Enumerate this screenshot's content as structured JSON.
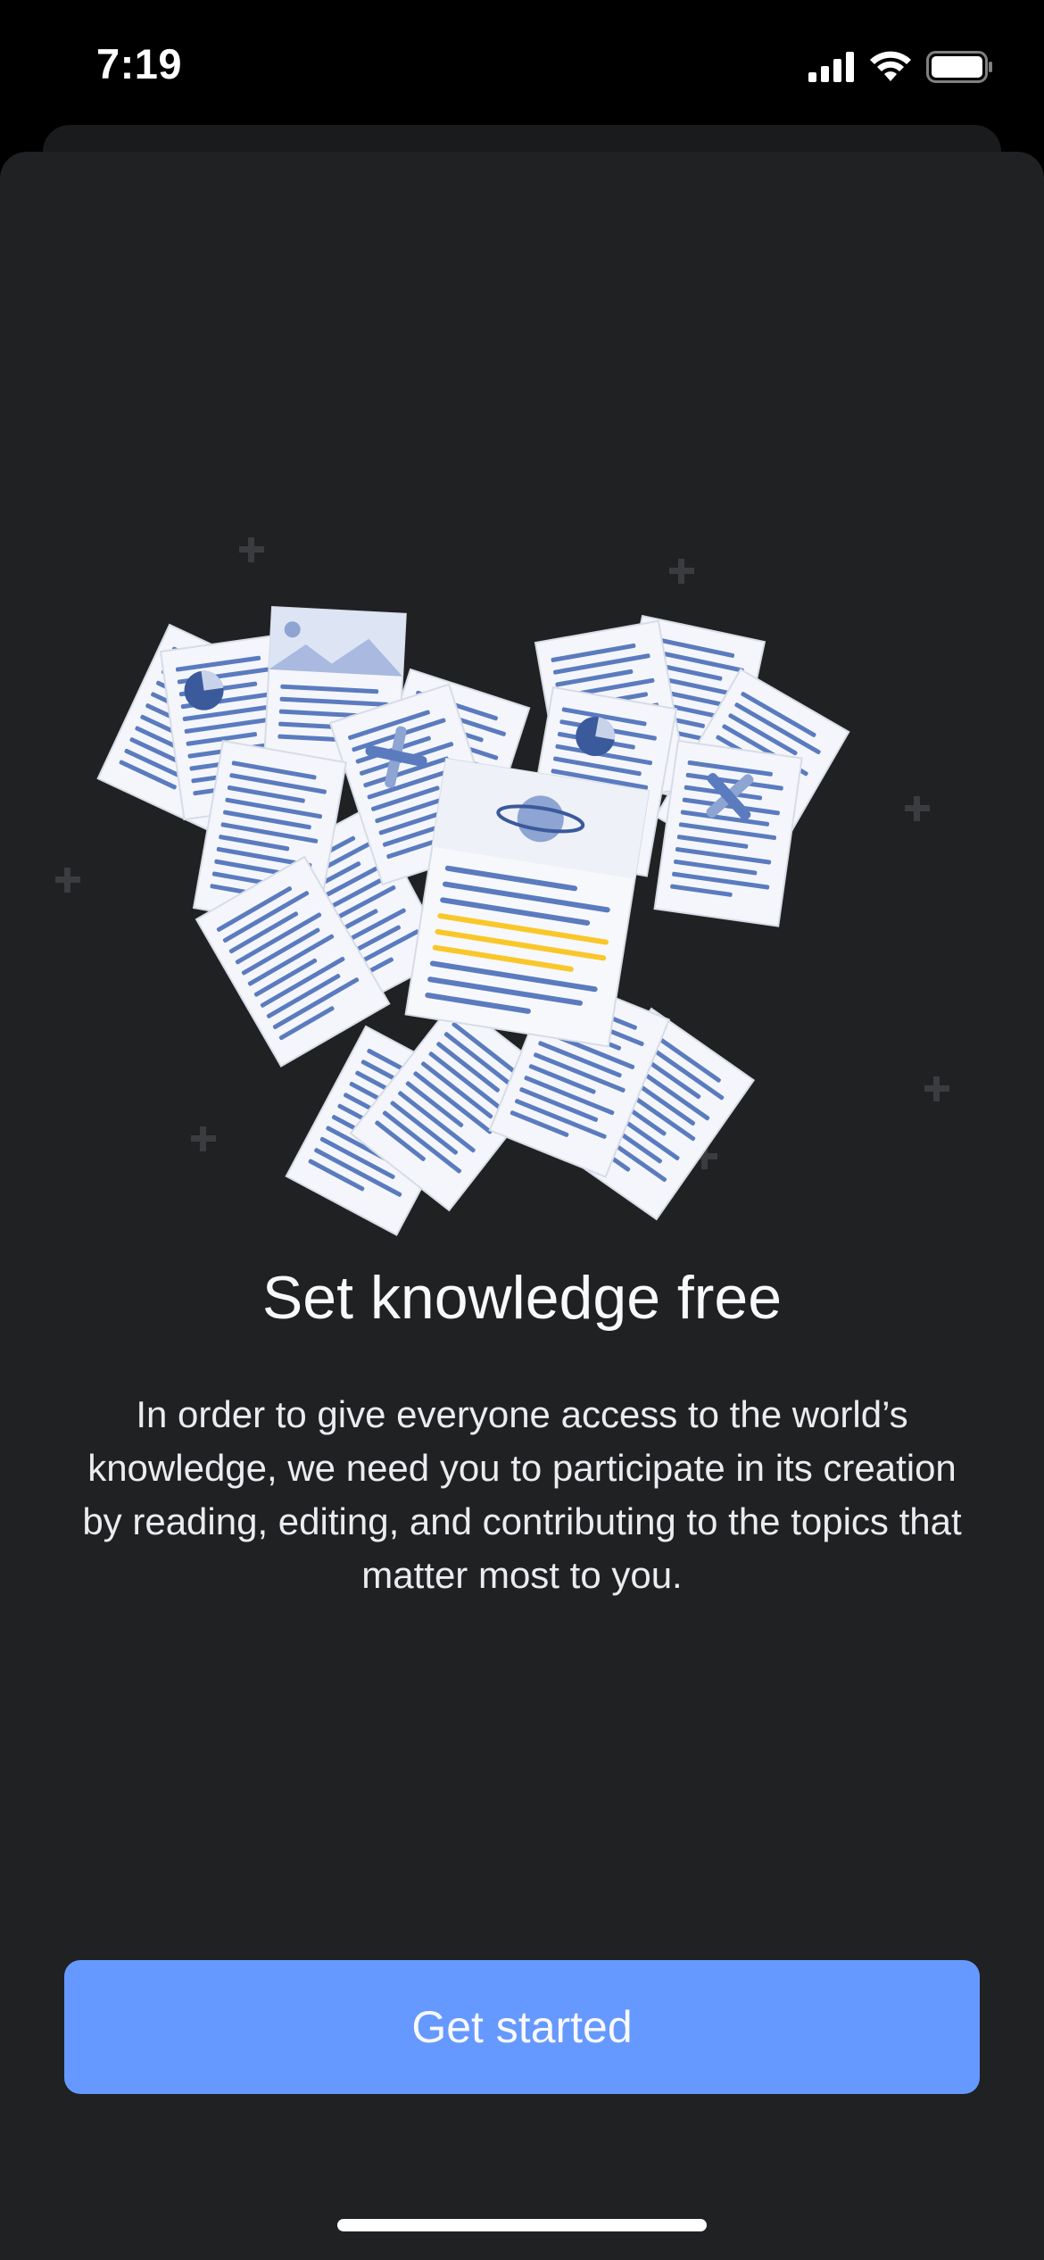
{
  "status_bar": {
    "time": "7:19",
    "icons": [
      "cellular-signal-icon",
      "wifi-icon",
      "battery-icon"
    ]
  },
  "onboarding": {
    "illustration": "heart-of-documents-illustration",
    "title": "Set knowledge free",
    "body": "In order to give everyone access to the world’s knowledge, we need you to participate in its creation by reading, editing, and contributing to the topics that matter most to you.",
    "cta_label": "Get started"
  },
  "colors": {
    "background": "#000000",
    "sheet": "#202122",
    "accent": "#6699ff",
    "text": "#f8f9fa"
  }
}
